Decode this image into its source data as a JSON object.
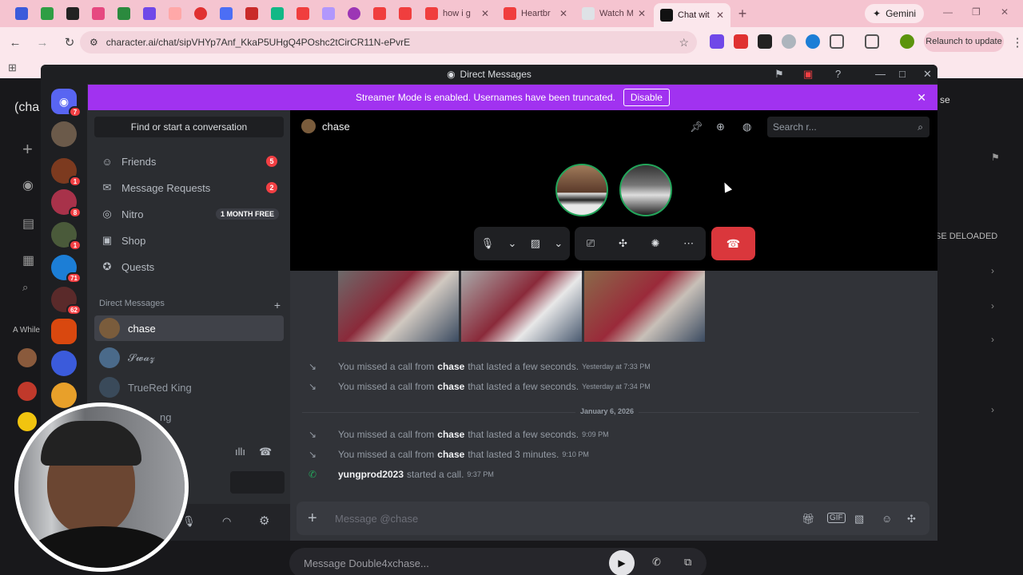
{
  "browser": {
    "tabs": [
      {
        "title": "how i g",
        "icon": "youtube-icon"
      },
      {
        "title": "Heartbr",
        "icon": "youtube-icon"
      },
      {
        "title": "Watch M",
        "icon": "watch-icon"
      },
      {
        "title": "Chat wit",
        "icon": "character-ai-icon"
      }
    ],
    "new_tab": "+",
    "gemini_label": "Gemini",
    "url": "character.ai/chat/sipVHYp7Anf_KkaP5UHgQ4POshc2tCirCR11N-ePvrE",
    "relaunch_label": "Relaunch to update"
  },
  "background_page": {
    "logo_text": "(cha",
    "while_text": "A While",
    "right_text": "se",
    "deloaded_text": "SE DELOADED",
    "message_placeholder": "Message Double4xchase..."
  },
  "discord": {
    "window_title": "Direct Messages",
    "banner_text": "Streamer Mode is enabled. Usernames have been truncated.",
    "banner_button": "Disable",
    "server_badges": [
      "7",
      "",
      "1",
      "8",
      "1",
      "71",
      "62"
    ],
    "find_conversation": "Find or start a conversation",
    "nav": [
      {
        "label": "Friends",
        "badge": "5"
      },
      {
        "label": "Message Requests",
        "badge": "2"
      },
      {
        "label": "Nitro",
        "promo": "1 MONTH FREE"
      },
      {
        "label": "Shop"
      },
      {
        "label": "Quests"
      }
    ],
    "dm_header": "Direct Messages",
    "dm_add": "+",
    "dms": [
      {
        "name": "chase"
      },
      {
        "name": "𝓢𝔀𝓪𝔃"
      },
      {
        "name": "TrueRed King"
      },
      {
        "name": "ng"
      }
    ],
    "chat": {
      "recipient": "chase",
      "search_placeholder": "Search r...",
      "messages": [
        {
          "pre": "You missed a call from",
          "user": "chase",
          "post": "that lasted a few seconds.",
          "time": "Yesterday at 7:33 PM"
        },
        {
          "pre": "You missed a call from",
          "user": "chase",
          "post": "that lasted a few seconds.",
          "time": "Yesterday at 7:34 PM"
        },
        {
          "pre": "You missed a call from",
          "user": "chase",
          "post": "that lasted a few seconds.",
          "time": "9:09 PM"
        },
        {
          "pre": "You missed a call from",
          "user": "chase",
          "post": "that lasted 3 minutes.",
          "time": "9:10 PM"
        },
        {
          "pre": "",
          "user": "yungprod2023",
          "post": "started a call.",
          "time": "9:37 PM"
        }
      ],
      "date_divider": "January 6, 2026",
      "message_placeholder": "Message @chase"
    }
  },
  "colors": {
    "accent": "#5865f2",
    "streamer_banner": "#a132f0",
    "hangup": "#da373c",
    "tab_strip": "#f5c4d0"
  }
}
